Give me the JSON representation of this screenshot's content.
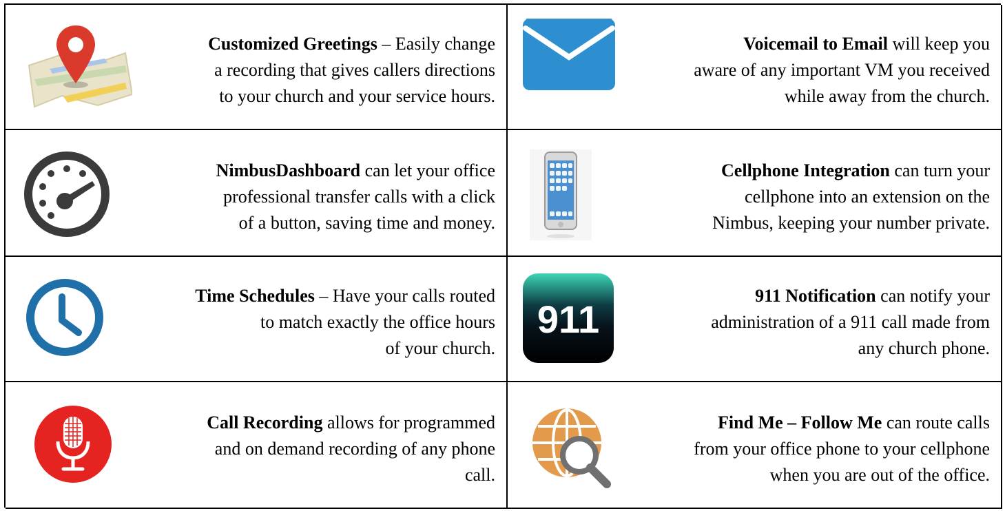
{
  "features": [
    {
      "id": "greetings",
      "icon": "map-pin-icon",
      "bold": "Customized Greetings",
      "lines": [
        "  – Easily change",
        "a recording that gives callers directions",
        "to your church and your service hours."
      ]
    },
    {
      "id": "voicemail",
      "icon": "envelope-icon",
      "bold": "Voicemail to Email",
      "lines": [
        " will keep you",
        "aware of any important VM you received",
        "while away from the church."
      ]
    },
    {
      "id": "dashboard",
      "icon": "speedometer-icon",
      "bold": "NimbusDashboard",
      "lines": [
        " can let your office",
        "professional transfer calls with a click",
        "of a button, saving time and money."
      ]
    },
    {
      "id": "cellphone",
      "icon": "smartphone-icon",
      "bold": "Cellphone Integration",
      "lines": [
        " can turn your",
        "cellphone into an extension on the",
        "Nimbus, keeping your number private."
      ]
    },
    {
      "id": "schedules",
      "icon": "clock-icon",
      "bold": "Time Schedules",
      "lines": [
        " – Have your calls routed",
        "to match exactly the office hours",
        "of your church."
      ]
    },
    {
      "id": "notification",
      "icon": "911-icon",
      "icon_text": "911",
      "bold": "911 Notification",
      "lines": [
        " can notify your",
        "administration of a 911 call made from",
        "any church phone."
      ]
    },
    {
      "id": "recording",
      "icon": "microphone-icon",
      "bold": "Call Recording",
      "lines": [
        " allows for programmed",
        "and on demand recording of any phone",
        "call."
      ]
    },
    {
      "id": "findme",
      "icon": "globe-search-icon",
      "bold": "Find Me – Follow Me",
      "lines": [
        " can route calls",
        "from your office phone to your cellphone",
        "when you are out of the office."
      ]
    }
  ],
  "colors": {
    "envelope": "#2e8fd0",
    "pin": "#d93a2b",
    "dashboard": "#3b3b3b",
    "clock": "#1f6fa8",
    "mic": "#e52320",
    "globe": "#e39a4a",
    "search": "#707070"
  }
}
